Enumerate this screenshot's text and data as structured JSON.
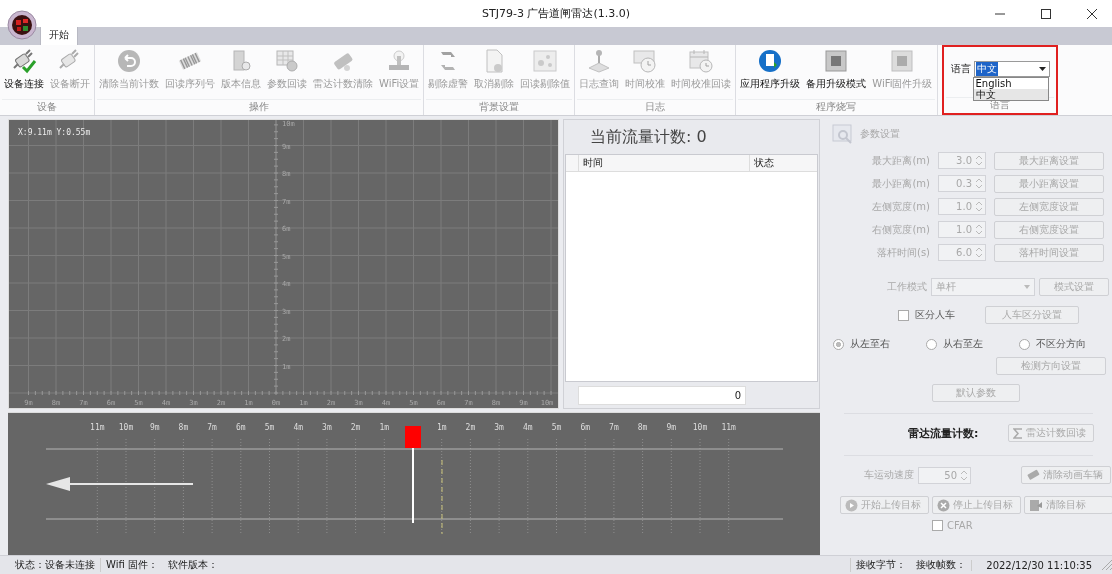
{
  "window": {
    "title": "STJ79-3 广告道闸雷达(1.3.0)"
  },
  "tabs": [
    {
      "label": "开始",
      "selected": true
    }
  ],
  "ribbon": {
    "groups": [
      {
        "label": "设备",
        "buttons": [
          {
            "label": "设备连接",
            "disabled": false
          },
          {
            "label": "设备断开",
            "disabled": true
          }
        ]
      },
      {
        "label": "操作",
        "buttons": [
          {
            "label": "清除当前计数",
            "disabled": true
          },
          {
            "label": "回读序列号",
            "disabled": true
          },
          {
            "label": "版本信息",
            "disabled": true
          },
          {
            "label": "参数回读",
            "disabled": true
          },
          {
            "label": "雷达计数清除",
            "disabled": true
          },
          {
            "label": "WiFi设置",
            "disabled": true
          }
        ]
      },
      {
        "label": "背景设置",
        "buttons": [
          {
            "label": "剔除虚警",
            "disabled": true
          },
          {
            "label": "取消剔除",
            "disabled": true
          },
          {
            "label": "回读剔除值",
            "disabled": true
          }
        ]
      },
      {
        "label": "日志",
        "buttons": [
          {
            "label": "日志查询",
            "disabled": true
          },
          {
            "label": "时间校准",
            "disabled": true
          },
          {
            "label": "时间校准回读",
            "disabled": true
          }
        ]
      },
      {
        "label": "程序烧写",
        "buttons": [
          {
            "label": "应用程序升级",
            "disabled": false
          },
          {
            "label": "备用升级模式",
            "disabled": false
          },
          {
            "label": "WiFi固件升级",
            "disabled": true
          }
        ]
      }
    ],
    "language": {
      "label": "语言",
      "value": "中文",
      "group_label": "语言",
      "highlighted": true,
      "options": [
        {
          "label": "English",
          "selected": false
        },
        {
          "label": "中文",
          "selected": true
        }
      ]
    }
  },
  "radar_plot": {
    "cursor": "X:9.11m  Y:0.55m",
    "x_labels": [
      "9m",
      "8m",
      "7m",
      "6m",
      "5m",
      "4m",
      "3m",
      "2m",
      "1m",
      "0m",
      "1m",
      "2m",
      "3m",
      "4m",
      "5m",
      "6m",
      "7m",
      "8m",
      "9m",
      "10m"
    ],
    "y_labels": [
      "10m",
      "9m",
      "8m",
      "7m",
      "6m",
      "5m",
      "4m",
      "3m",
      "2m",
      "1m"
    ]
  },
  "flow_count": {
    "title": "当前流量计数: 0",
    "columns": [
      "时间",
      "状态"
    ],
    "total": "0"
  },
  "lane_view": {
    "left_labels": [
      "11m",
      "10m",
      "9m",
      "8m",
      "7m",
      "6m",
      "5m",
      "4m",
      "3m",
      "2m",
      "1m"
    ],
    "right_labels": [
      "1m",
      "2m",
      "3m",
      "4m",
      "5m",
      "6m",
      "7m",
      "8m",
      "9m",
      "10m",
      "11m"
    ]
  },
  "parameters": {
    "title": "参数设置",
    "disabled": true,
    "fields": [
      {
        "label": "最大距离(m)",
        "value": "3.0",
        "button": "最大距离设置"
      },
      {
        "label": "最小距离(m)",
        "value": "0.3",
        "button": "最小距离设置"
      },
      {
        "label": "左侧宽度(m)",
        "value": "1.0",
        "button": "左侧宽度设置"
      },
      {
        "label": "右侧宽度(m)",
        "value": "1.0",
        "button": "右侧宽度设置"
      },
      {
        "label": "落杆时间(s)",
        "value": "6.0",
        "button": "落杆时间设置"
      }
    ],
    "work_mode": {
      "label": "工作模式",
      "value": "单杆",
      "button": "模式设置"
    },
    "separate": {
      "label": "区分人车",
      "checked": false,
      "button": "人车区分设置"
    },
    "directions": [
      {
        "label": "从左至右",
        "selected": true
      },
      {
        "label": "从右至左",
        "selected": false
      },
      {
        "label": "不区分方向",
        "selected": false
      }
    ],
    "direction_button": "检测方向设置",
    "default_button": "默认参数"
  },
  "radar_count": {
    "label": "雷达流量计数:",
    "button": "雷达计数回读"
  },
  "speed": {
    "label": "车运动速度",
    "value": "50",
    "button": "清除动画车辆"
  },
  "target_buttons": [
    "开始上传目标",
    "停止上传目标",
    "清除目标"
  ],
  "cfar": {
    "label": "CFAR",
    "checked": false
  },
  "status_bar": {
    "left": [
      "状态：设备未连接",
      "Wifi 固件：",
      "软件版本："
    ],
    "right": [
      "接收字节：",
      "接收帧数：",
      "2022/12/30 11:10:35"
    ]
  }
}
